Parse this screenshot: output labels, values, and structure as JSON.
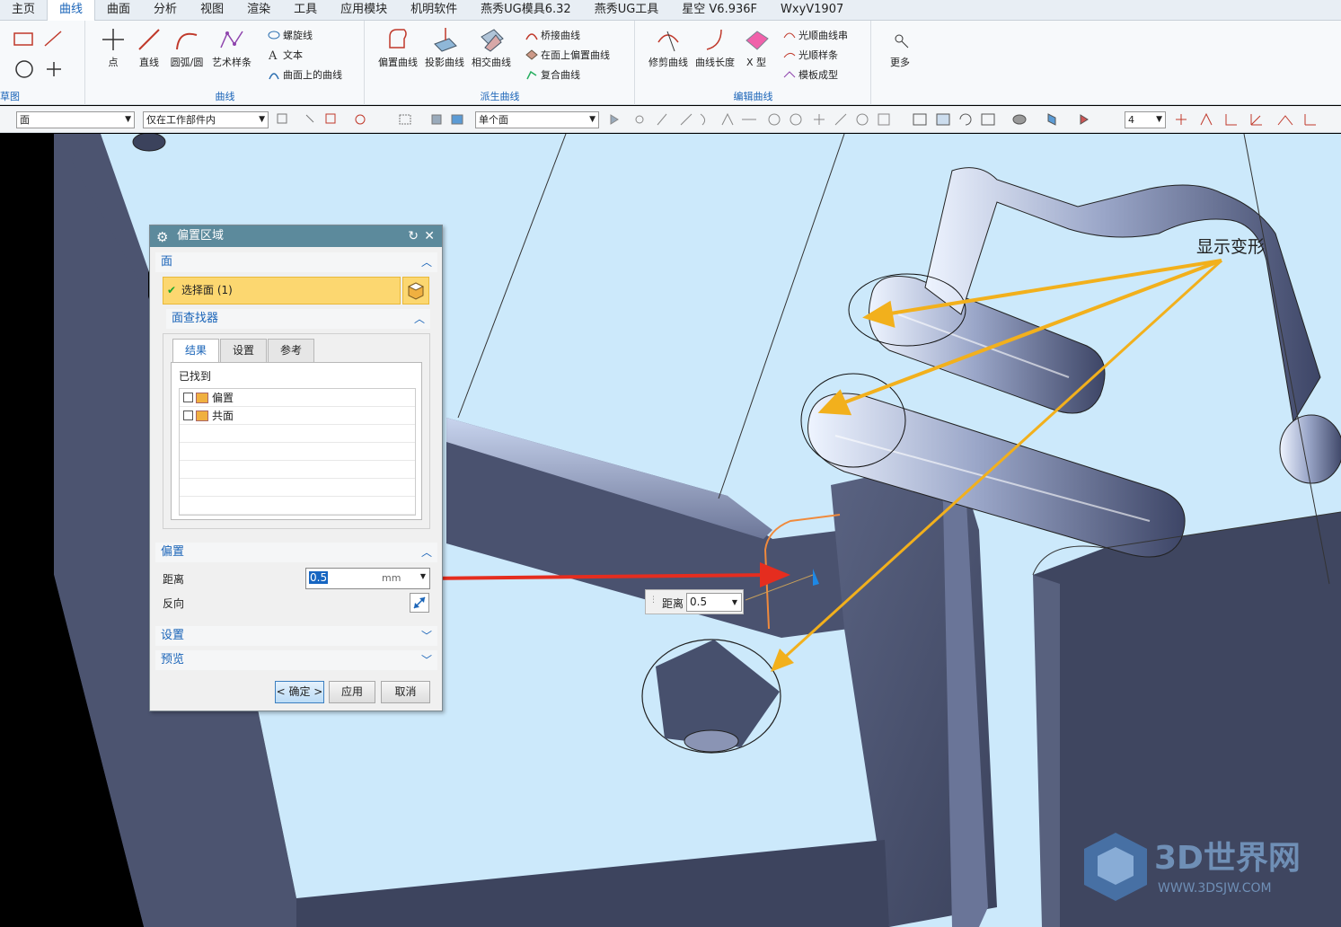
{
  "menu": {
    "items": [
      "主页",
      "曲线",
      "曲面",
      "分析",
      "视图",
      "渲染",
      "工具",
      "应用模块",
      "机明软件",
      "燕秀UG模具6.32",
      "燕秀UG工具",
      "星空 V6.936F",
      "WxyV1907"
    ],
    "active_index": 1
  },
  "ribbon": {
    "sketch_group": {
      "label": "草图"
    },
    "curve_group": {
      "label": "曲线",
      "point": "点",
      "line": "直线",
      "arc": "圆弧/圆",
      "art_spline": "艺术样条",
      "helix": "螺旋线",
      "text": "文本",
      "curve_on_surface": "曲面上的曲线"
    },
    "derived_group": {
      "label": "派生曲线",
      "offset_curve": "偏置曲线",
      "project_curve": "投影曲线",
      "intersect_curve": "相交曲线",
      "bridge_curve": "桥接曲线",
      "offset_on_face": "在面上偏置曲线",
      "composite_curve": "复合曲线"
    },
    "edit_group": {
      "label": "编辑曲线",
      "trim_curve": "修剪曲线",
      "curve_length": "曲线长度",
      "x_form": "X 型",
      "smooth_string": "光顺曲线串",
      "smooth_spline": "光顺样条",
      "template_form": "模板成型"
    },
    "more": "更多"
  },
  "toolbar": {
    "filter_type": "面",
    "scope": "仅在工作部件内",
    "face_rule": "单个面",
    "count": "4"
  },
  "dialog": {
    "title": "偏置区域",
    "face_section": "面",
    "select_face": "选择面 (1)",
    "finder_section": "面查找器",
    "tabs": [
      "结果",
      "设置",
      "参考"
    ],
    "found_label": "已找到",
    "found_items": [
      "偏置",
      "共面"
    ],
    "offset_section": "偏置",
    "distance_label": "距离",
    "distance_value": "0.5",
    "distance_unit": "mm",
    "reverse_label": "反向",
    "settings_section": "设置",
    "preview_section": "预览",
    "ok": "< 确定 >",
    "apply": "应用",
    "cancel": "取消"
  },
  "onscreen": {
    "distance_label": "距离",
    "distance_value": "0.5"
  },
  "annotation": {
    "text": "显示变形"
  },
  "watermark": {
    "brand": "3D世界网",
    "url": "WWW.3DSJW.COM"
  }
}
